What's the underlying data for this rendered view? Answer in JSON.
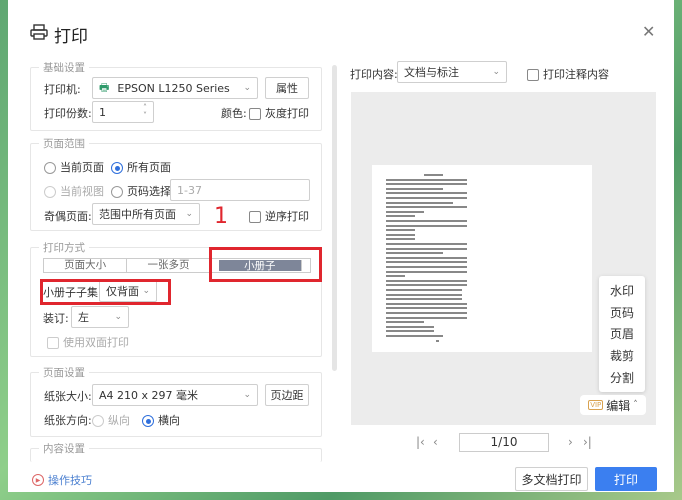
{
  "title": "打印",
  "left": {
    "basic": {
      "legend": "基础设置",
      "printer_label": "打印机:",
      "printer": "EPSON L1250 Series",
      "properties": "属性",
      "copies_label": "打印份数:",
      "copies": "1",
      "color_label": "颜色:",
      "grayscale": "灰度打印"
    },
    "range": {
      "legend": "页面范围",
      "current_page": "当前页面",
      "all_pages": "所有页面",
      "current_view": "当前视图",
      "page_select": "页码选择:",
      "page_select_placeholder": "1-37",
      "odd_even_label": "奇偶页面:",
      "odd_even": "范围中所有页面",
      "reverse": "逆序打印"
    },
    "annotation": "1",
    "mode": {
      "legend": "打印方式",
      "tabs": [
        "页面大小",
        "一张多页",
        "小册子"
      ],
      "subset_label": "小册子子集:",
      "subset": "仅背面",
      "binding_label": "装订:",
      "binding": "左",
      "duplex": "使用双面打印"
    },
    "pagesetup": {
      "legend": "页面设置",
      "size_label": "纸张大小:",
      "size": "A4 210 x 297 毫米",
      "margins": "页边距",
      "orient_label": "纸张方向:",
      "portrait": "纵向",
      "landscape": "横向"
    },
    "content": {
      "legend": "内容设置"
    },
    "tips": "操作技巧"
  },
  "right": {
    "content_label": "打印内容:",
    "content": "文档与标注",
    "print_comments": "打印注释内容",
    "menu": [
      "水印",
      "页码",
      "页眉",
      "裁剪",
      "分割"
    ],
    "vip": "VIP",
    "edit": "编辑",
    "page": "1/10",
    "multi_print": "多文档打印",
    "print": "打印"
  }
}
